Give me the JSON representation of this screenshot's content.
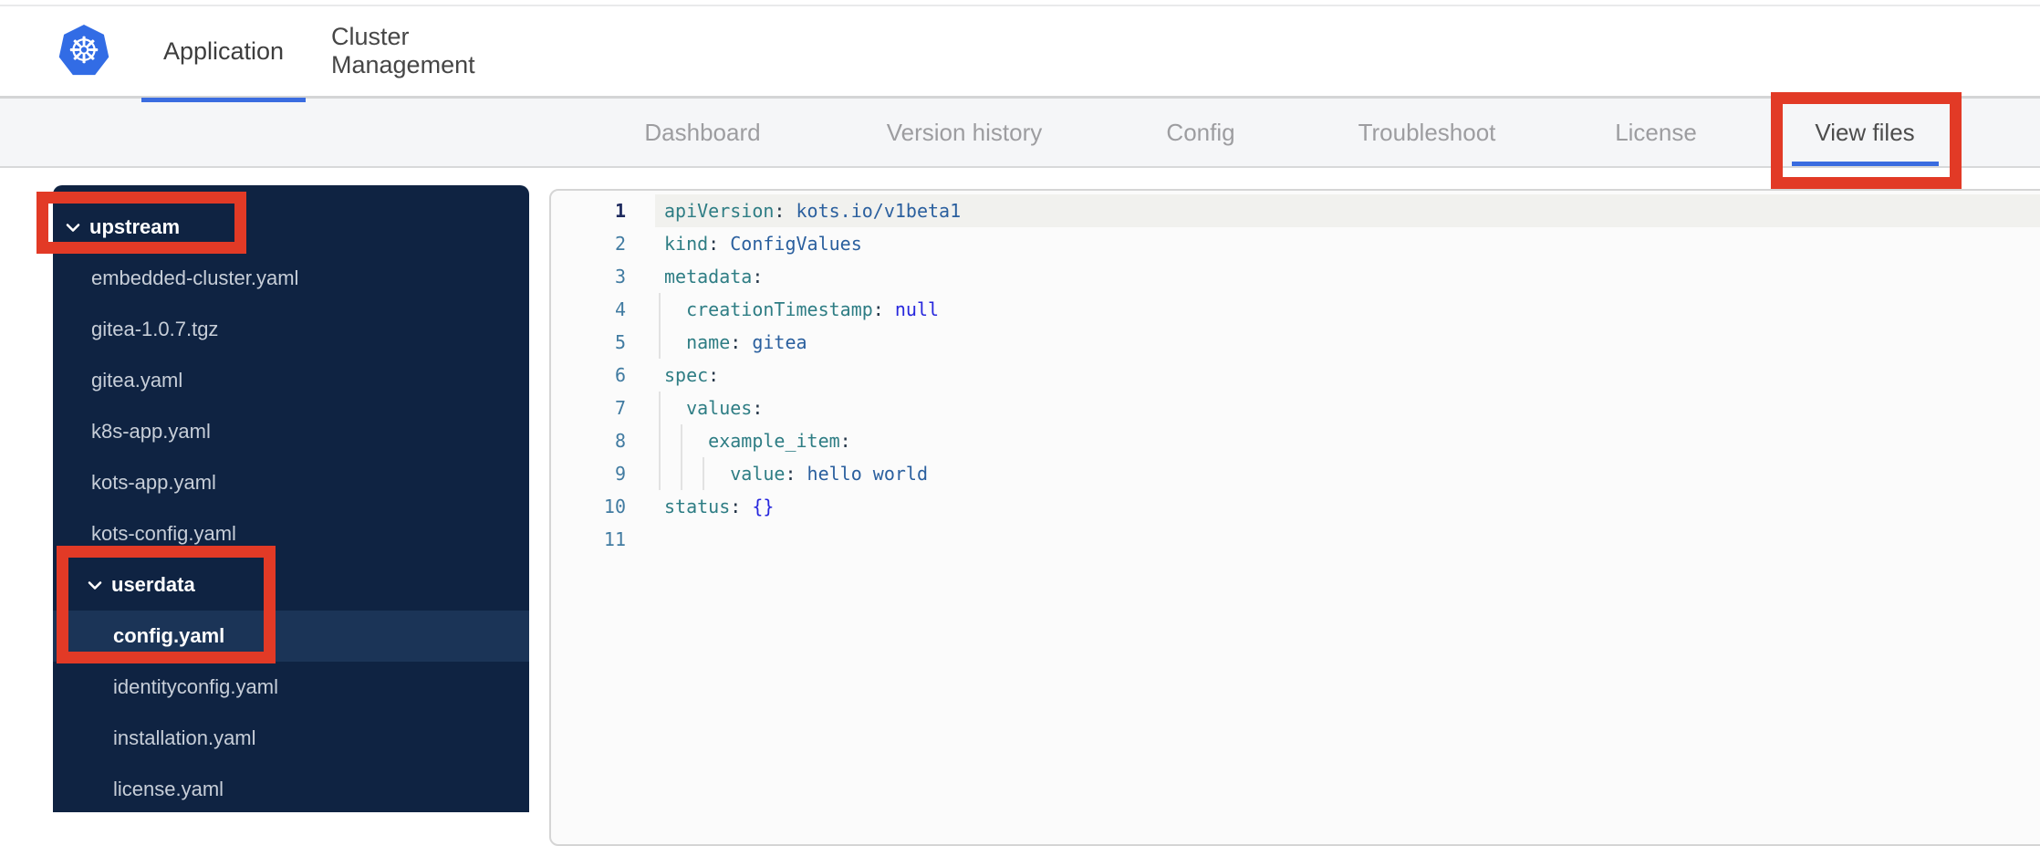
{
  "header": {
    "logo": "kubernetes-logo",
    "tabs": [
      {
        "label": "Application",
        "active": true
      },
      {
        "label": "Cluster Management",
        "active": false
      }
    ]
  },
  "subnav": {
    "tabs": [
      {
        "label": "Dashboard",
        "active": false
      },
      {
        "label": "Version history",
        "active": false
      },
      {
        "label": "Config",
        "active": false
      },
      {
        "label": "Troubleshoot",
        "active": false
      },
      {
        "label": "License",
        "active": false
      },
      {
        "label": "View files",
        "active": true
      }
    ]
  },
  "file_tree": {
    "items": [
      {
        "label": "upstream",
        "type": "folder",
        "level": 0,
        "expanded": true,
        "selected": false
      },
      {
        "label": "embedded-cluster.yaml",
        "type": "file",
        "level": 0,
        "selected": false
      },
      {
        "label": "gitea-1.0.7.tgz",
        "type": "file",
        "level": 0,
        "selected": false
      },
      {
        "label": "gitea.yaml",
        "type": "file",
        "level": 0,
        "selected": false
      },
      {
        "label": "k8s-app.yaml",
        "type": "file",
        "level": 0,
        "selected": false
      },
      {
        "label": "kots-app.yaml",
        "type": "file",
        "level": 0,
        "selected": false
      },
      {
        "label": "kots-config.yaml",
        "type": "file",
        "level": 0,
        "selected": false
      },
      {
        "label": "userdata",
        "type": "folder",
        "level": 1,
        "expanded": true,
        "selected": false
      },
      {
        "label": "config.yaml",
        "type": "file",
        "level": 1,
        "selected": true
      },
      {
        "label": "identityconfig.yaml",
        "type": "file",
        "level": 1,
        "selected": false
      },
      {
        "label": "installation.yaml",
        "type": "file",
        "level": 1,
        "selected": false
      },
      {
        "label": "license.yaml",
        "type": "file",
        "level": 1,
        "selected": false
      }
    ]
  },
  "editor": {
    "file": "config.yaml",
    "lines": [
      {
        "num": 1,
        "active": true,
        "guides": 0,
        "tokens": [
          [
            "key",
            "apiVersion"
          ],
          [
            "colon",
            ":"
          ],
          [
            "val",
            " kots.io/v1beta1"
          ]
        ]
      },
      {
        "num": 2,
        "active": false,
        "guides": 0,
        "tokens": [
          [
            "key",
            "kind"
          ],
          [
            "colon",
            ":"
          ],
          [
            "val",
            " ConfigValues"
          ]
        ]
      },
      {
        "num": 3,
        "active": false,
        "guides": 0,
        "tokens": [
          [
            "key",
            "metadata"
          ],
          [
            "colon",
            ":"
          ]
        ]
      },
      {
        "num": 4,
        "active": false,
        "guides": 1,
        "tokens": [
          [
            "plain",
            "  "
          ],
          [
            "key",
            "creationTimestamp"
          ],
          [
            "colon",
            ":"
          ],
          [
            "kw",
            " null"
          ]
        ]
      },
      {
        "num": 5,
        "active": false,
        "guides": 1,
        "tokens": [
          [
            "plain",
            "  "
          ],
          [
            "key",
            "name"
          ],
          [
            "colon",
            ":"
          ],
          [
            "val",
            " gitea"
          ]
        ]
      },
      {
        "num": 6,
        "active": false,
        "guides": 0,
        "tokens": [
          [
            "key",
            "spec"
          ],
          [
            "colon",
            ":"
          ]
        ]
      },
      {
        "num": 7,
        "active": false,
        "guides": 1,
        "tokens": [
          [
            "plain",
            "  "
          ],
          [
            "key",
            "values"
          ],
          [
            "colon",
            ":"
          ]
        ]
      },
      {
        "num": 8,
        "active": false,
        "guides": 2,
        "tokens": [
          [
            "plain",
            "    "
          ],
          [
            "key",
            "example_item"
          ],
          [
            "colon",
            ":"
          ]
        ]
      },
      {
        "num": 9,
        "active": false,
        "guides": 3,
        "tokens": [
          [
            "plain",
            "      "
          ],
          [
            "key",
            "value"
          ],
          [
            "colon",
            ":"
          ],
          [
            "val",
            " hello world"
          ]
        ]
      },
      {
        "num": 10,
        "active": false,
        "guides": 0,
        "tokens": [
          [
            "key",
            "status"
          ],
          [
            "colon",
            ":"
          ],
          [
            "kw",
            " {}"
          ]
        ]
      },
      {
        "num": 11,
        "active": false,
        "guides": 0,
        "tokens": []
      }
    ]
  },
  "annotations": [
    {
      "target": "view-files-tab"
    },
    {
      "target": "upstream-folder"
    },
    {
      "target": "userdata-config-rows"
    }
  ],
  "colors": {
    "annotation_red": "#e23a26",
    "kubernetes_blue": "#326ce5",
    "tab_underline_blue": "#3a6ce0",
    "sidebar_bg": "#0f2342",
    "sidebar_selected_bg": "#1b3457",
    "yaml_key": "#2e7d84",
    "yaml_value": "#2a5f9e",
    "yaml_keyword": "#2727dd"
  }
}
